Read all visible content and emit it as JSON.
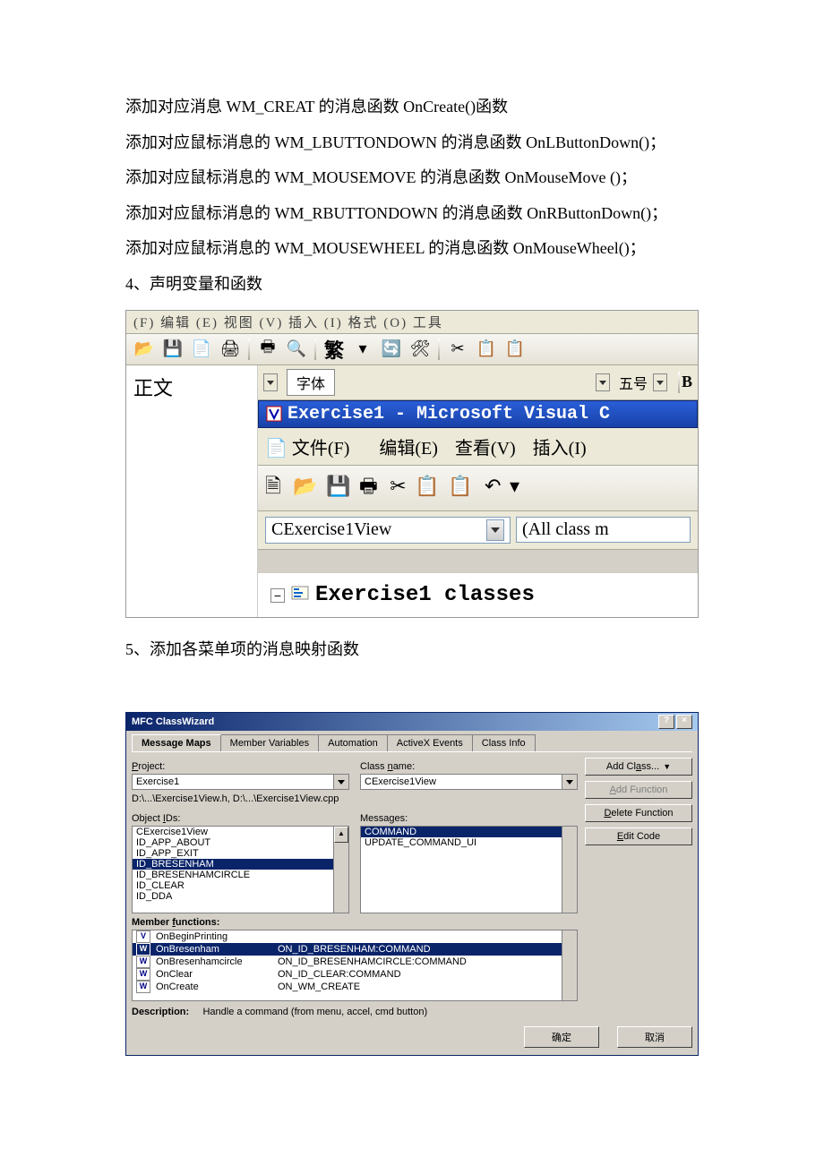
{
  "paragraphs": {
    "p1": "添加对应消息 WM_CREAT 的消息函数 OnCreate()函数",
    "p2": "添加对应鼠标消息的 WM_LBUTTONDOWN 的消息函数 OnLButtonDown()；",
    "p3": "添加对应鼠标消息的 WM_MOUSEMOVE 的消息函数 OnMouseMove ()；",
    "p4": "添加对应鼠标消息的 WM_RBUTTONDOWN 的消息函数 OnRButtonDown()；",
    "p5": "添加对应鼠标消息的 WM_MOUSEWHEEL 的消息函数 OnMouseWheel()；",
    "p6": "4、声明变量和函数",
    "p7": "5、添加各菜单项的消息映射函数"
  },
  "word_ide": {
    "menubar_fragment": "(F)    编辑 (E)    视图 (V)    插入 (I)    格式 (O)    工具",
    "style_name": "正文",
    "font_label": "字体",
    "size_label": "五号"
  },
  "vc_ide": {
    "title": "Exercise1 - Microsoft Visual C",
    "menu_file": "文件(F)",
    "menu_edit": "编辑(E)",
    "menu_view": "查看(V)",
    "menu_insert": "插入(I)",
    "class_combo": "CExercise1View",
    "filter_combo": "(All class m",
    "tree_root": "Exercise1 classes"
  },
  "wizard": {
    "title": "MFC ClassWizard",
    "tabs": {
      "t1": "Message Maps",
      "t2": "Member Variables",
      "t3": "Automation",
      "t4": "ActiveX Events",
      "t5": "Class Info"
    },
    "labels": {
      "project": "Project:",
      "class_name": "Class name:",
      "object_ids": "Object IDs:",
      "messages": "Messages:",
      "member_functions": "Member functions:",
      "description": "Description:"
    },
    "project_value": "Exercise1",
    "class_value": "CExercise1View",
    "path_line": "D:\\...\\Exercise1View.h, D:\\...\\Exercise1View.cpp",
    "object_ids": {
      "i0": "CExercise1View",
      "i1": "ID_APP_ABOUT",
      "i2": "ID_APP_EXIT",
      "i3": "ID_BRESENHAM",
      "i4": "ID_BRESENHAMCIRCLE",
      "i5": "ID_CLEAR",
      "i6": "ID_DDA"
    },
    "messages_list": {
      "m0": "COMMAND",
      "m1": "UPDATE_COMMAND_UI"
    },
    "member_functions": {
      "r0": {
        "badge": "V",
        "name": "OnBeginPrinting",
        "map": ""
      },
      "r1": {
        "badge": "W",
        "name": "OnBresenham",
        "map": "ON_ID_BRESENHAM:COMMAND"
      },
      "r2": {
        "badge": "W",
        "name": "OnBresenhamcircle",
        "map": "ON_ID_BRESENHAMCIRCLE:COMMAND"
      },
      "r3": {
        "badge": "W",
        "name": "OnClear",
        "map": "ON_ID_CLEAR:COMMAND"
      },
      "r4": {
        "badge": "W",
        "name": "OnCreate",
        "map": "ON_WM_CREATE"
      }
    },
    "description_text": "Handle a command (from menu, accel, cmd button)",
    "buttons": {
      "add_class": "Add Class...",
      "add_function": "Add Function",
      "delete_function": "Delete Function",
      "edit_code": "Edit Code",
      "ok": "确定",
      "cancel": "取消"
    }
  }
}
